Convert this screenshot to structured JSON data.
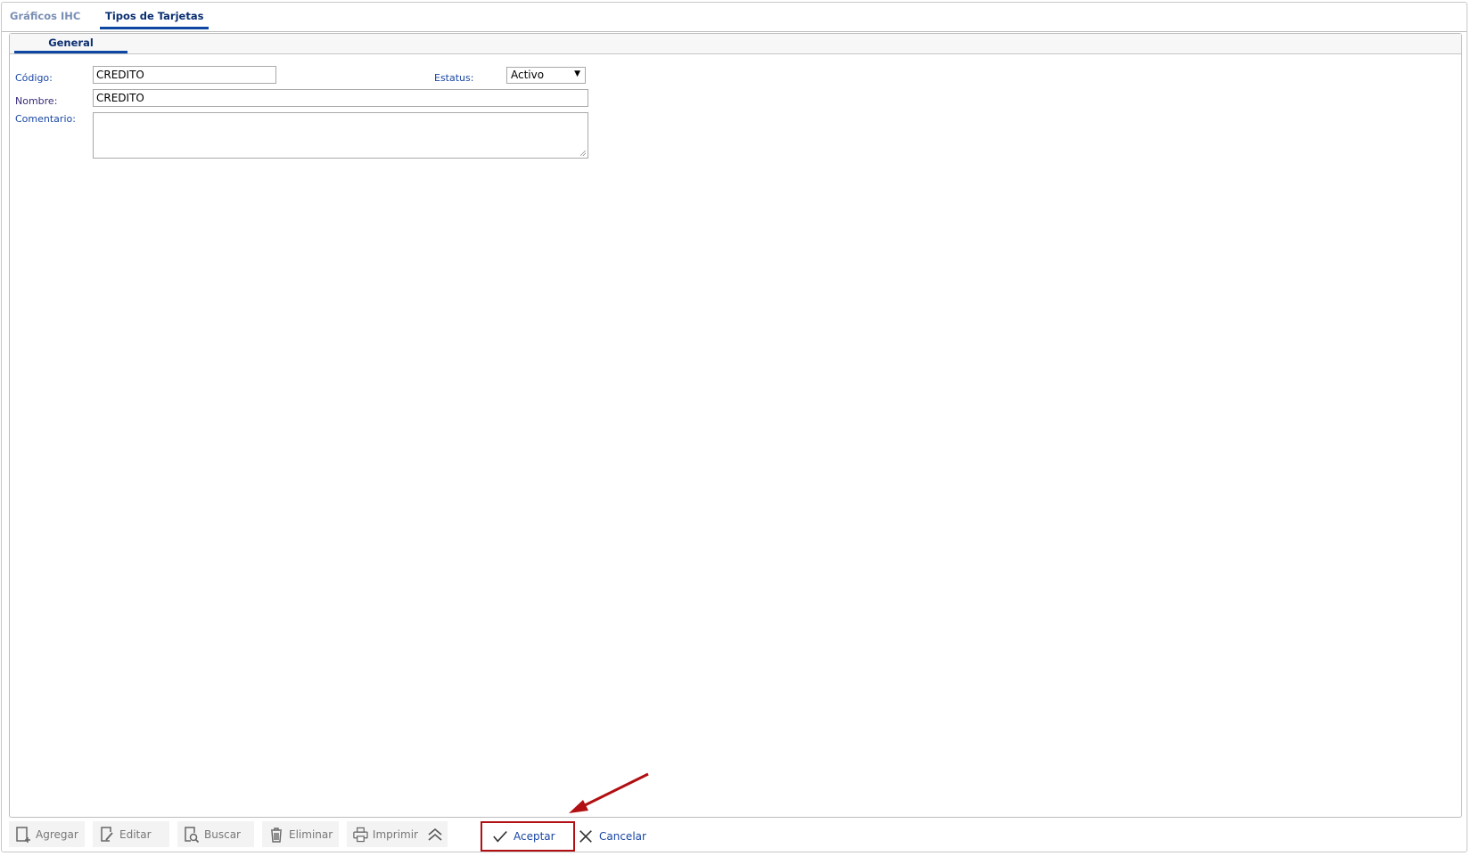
{
  "tabs": [
    {
      "label": "Gráficos IHC",
      "active": false
    },
    {
      "label": "Tipos de Tarjetas",
      "active": true
    }
  ],
  "panel_tab": "General",
  "form": {
    "codigo_label": "Código:",
    "codigo_value": "CREDITO",
    "estatus_label": "Estatus:",
    "estatus_value": "Activo",
    "nombre_label": "Nombre:",
    "nombre_value": "CREDITO",
    "comentario_label": "Comentario:",
    "comentario_value": ""
  },
  "toolbar": {
    "agregar": "Agregar",
    "editar": "Editar",
    "buscar": "Buscar",
    "eliminar": "Eliminar",
    "imprimir": "Imprimir",
    "aceptar": "Aceptar",
    "cancelar": "Cancelar"
  },
  "colors": {
    "accent": "#0d47a1",
    "label": "#1a47a3",
    "highlight": "#b10f12"
  }
}
